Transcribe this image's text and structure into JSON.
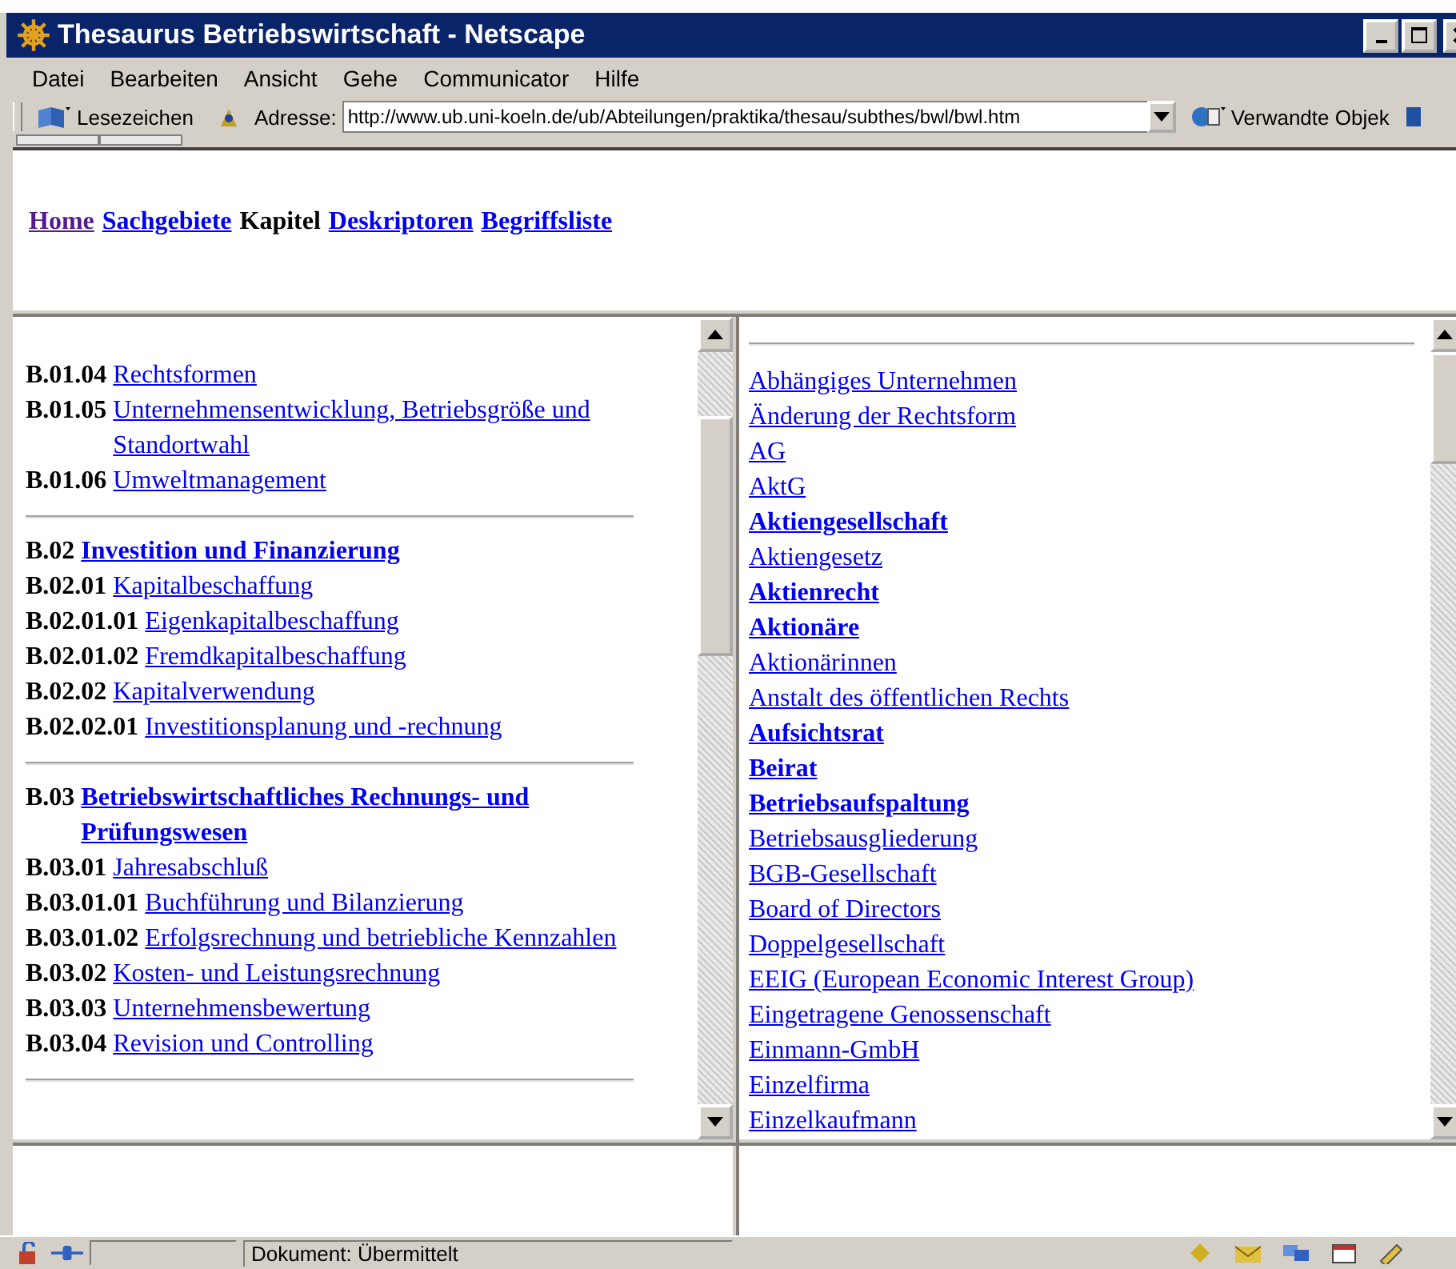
{
  "window": {
    "title": "Thesaurus Betriebswirtschaft - Netscape"
  },
  "menu": [
    "Datei",
    "Bearbeiten",
    "Ansicht",
    "Gehe",
    "Communicator",
    "Hilfe"
  ],
  "toolbar": {
    "bookmarks": "Lesezeichen",
    "address_label": "Adresse:",
    "url": "http://www.ub.uni-koeln.de/ub/Abteilungen/praktika/thesau/subthes/bwl/bwl.htm",
    "related": "Verwandte Objek"
  },
  "nav": [
    {
      "label": "Home",
      "kind": "visited"
    },
    {
      "label": "Sachgebiete",
      "kind": "link"
    },
    {
      "label": "Kapitel",
      "kind": "current"
    },
    {
      "label": "Deskriptoren",
      "kind": "link"
    },
    {
      "label": "Begriffsliste",
      "kind": "link"
    }
  ],
  "chapters": [
    {
      "entries": [
        {
          "code": "B.01.04",
          "label": "Rechtsformen",
          "bold": false
        },
        {
          "code": "B.01.05",
          "label": "Unternehmensentwicklung, Betriebsgröße und Standortwahl",
          "bold": false
        },
        {
          "code": "B.01.06",
          "label": "Umweltmanagement",
          "bold": false
        }
      ]
    },
    {
      "entries": [
        {
          "code": "B.02",
          "label": "Investition und Finanzierung",
          "bold": true
        },
        {
          "code": "B.02.01",
          "label": "Kapitalbeschaffung",
          "bold": false
        },
        {
          "code": "B.02.01.01",
          "label": "Eigenkapitalbeschaffung",
          "bold": false
        },
        {
          "code": "B.02.01.02",
          "label": "Fremdkapitalbeschaffung",
          "bold": false
        },
        {
          "code": "B.02.02",
          "label": "Kapitalverwendung",
          "bold": false
        },
        {
          "code": "B.02.02.01",
          "label": "Investitionsplanung und -rechnung",
          "bold": false
        }
      ]
    },
    {
      "entries": [
        {
          "code": "B.03",
          "label": "Betriebswirtschaftliches Rechnungs- und Prüfungswesen",
          "bold": true
        },
        {
          "code": "B.03.01",
          "label": "Jahresabschluß",
          "bold": false
        },
        {
          "code": "B.03.01.01",
          "label": "Buchführung und Bilanzierung",
          "bold": false
        },
        {
          "code": "B.03.01.02",
          "label": "Erfolgsrechnung und betriebliche Kennzahlen",
          "bold": false
        },
        {
          "code": "B.03.02",
          "label": "Kosten- und Leistungsrechnung",
          "bold": false
        },
        {
          "code": "B.03.03",
          "label": "Unternehmensbewertung",
          "bold": false
        },
        {
          "code": "B.03.04",
          "label": "Revision und Controlling",
          "bold": false
        }
      ]
    }
  ],
  "terms": [
    {
      "label": "Abhängiges Unternehmen",
      "bold": false
    },
    {
      "label": "Änderung der Rechtsform",
      "bold": false
    },
    {
      "label": "AG",
      "bold": false
    },
    {
      "label": "AktG",
      "bold": false
    },
    {
      "label": "Aktiengesellschaft",
      "bold": true
    },
    {
      "label": "Aktiengesetz",
      "bold": false
    },
    {
      "label": "Aktienrecht",
      "bold": true
    },
    {
      "label": "Aktionäre",
      "bold": true
    },
    {
      "label": "Aktionärinnen",
      "bold": false
    },
    {
      "label": "Anstalt des öffentlichen Rechts",
      "bold": false
    },
    {
      "label": "Aufsichtsrat",
      "bold": true
    },
    {
      "label": "Beirat",
      "bold": true
    },
    {
      "label": "Betriebsaufspaltung",
      "bold": true
    },
    {
      "label": "Betriebsausgliederung",
      "bold": false
    },
    {
      "label": "BGB-Gesellschaft",
      "bold": false
    },
    {
      "label": "Board of Directors",
      "bold": false
    },
    {
      "label": "Doppelgesellschaft",
      "bold": false
    },
    {
      "label": "EEIG (European Economic Interest Group)",
      "bold": false
    },
    {
      "label": "Eingetragene Genossenschaft",
      "bold": false
    },
    {
      "label": "Einmann-GmbH",
      "bold": false
    },
    {
      "label": "Einzelfirma",
      "bold": false
    },
    {
      "label": "Einzelkaufmann",
      "bold": false
    }
  ],
  "status_bar": {
    "text": "Dokument: Übermittelt"
  }
}
